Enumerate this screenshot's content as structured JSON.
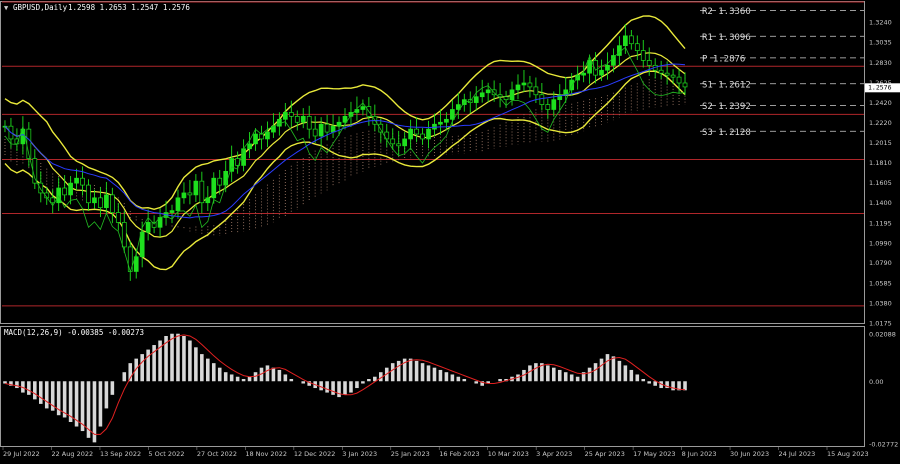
{
  "header": {
    "symbol": "GBPUSD,Daily",
    "ohlc": "1.2598 1.2653 1.2547 1.2576"
  },
  "macd": {
    "label": "MACD(12,26,9) -0.00385 -0.00273",
    "ticks": [
      "0.02088",
      "0.00",
      "-0.02772"
    ]
  },
  "chart_data": {
    "type": "candlestick",
    "symbol": "GBPUSD",
    "timeframe": "Daily",
    "last_price": 1.2576,
    "ylim": [
      1.0175,
      1.3445
    ],
    "y_ticks": [
      1.324,
      1.3035,
      1.283,
      1.2625,
      1.242,
      1.222,
      1.2015,
      1.181,
      1.1605,
      1.14,
      1.1195,
      1.099,
      1.079,
      1.0585,
      1.038,
      1.0175
    ],
    "y_tick_labels": [
      "1.3240",
      "1.3035",
      "1.2830",
      "1.2625",
      "1.2420",
      "1.2220",
      "1.2015",
      "1.1810",
      "1.1605",
      "1.1400",
      "1.1195",
      "1.0990",
      "1.0790",
      "1.0585",
      "1.0380",
      "1.0175"
    ],
    "x_labels": [
      "29 Jul 2022",
      "22 Aug 2022",
      "13 Sep 2022",
      "5 Oct 2022",
      "27 Oct 2022",
      "18 Nov 2022",
      "12 Dec 2022",
      "3 Jan 2023",
      "25 Jan 2023",
      "16 Feb 2023",
      "10 Mar 2023",
      "3 Apr 2023",
      "25 Apr 2023",
      "17 May 2023",
      "8 Jun 2023",
      "30 Jun 2023",
      "24 Jul 2023",
      "15 Aug 2023"
    ],
    "pivot_levels": [
      {
        "label": "R2 1.3360",
        "value": 1.336
      },
      {
        "label": "R1 1.3096",
        "value": 1.3096
      },
      {
        "label": "P 1.2876",
        "value": 1.2876
      },
      {
        "label": "S1 1.2612",
        "value": 1.2612
      },
      {
        "label": "S2 1.2392",
        "value": 1.2392
      },
      {
        "label": "S3 1.2128",
        "value": 1.2128
      }
    ],
    "horizontal_lines": [
      1.3445,
      1.279,
      1.23,
      1.184,
      1.129,
      1.035
    ],
    "price_path": [
      1.218,
      1.205,
      1.2,
      1.215,
      1.185,
      1.16,
      1.15,
      1.145,
      1.14,
      1.155,
      1.148,
      1.16,
      1.165,
      1.158,
      1.14,
      1.145,
      1.135,
      1.148,
      1.13,
      1.12,
      1.095,
      1.07,
      1.085,
      1.11,
      1.12,
      1.115,
      1.125,
      1.13,
      1.132,
      1.145,
      1.15,
      1.148,
      1.162,
      1.14,
      1.145,
      1.165,
      1.158,
      1.172,
      1.185,
      1.178,
      1.195,
      1.2,
      1.21,
      1.205,
      1.212,
      1.218,
      1.225,
      1.232,
      1.228,
      1.222,
      1.228,
      1.215,
      1.208,
      1.22,
      1.212,
      1.218,
      1.222,
      1.228,
      1.232,
      1.235,
      1.238,
      1.228,
      1.22,
      1.212,
      1.205,
      1.2,
      1.198,
      1.205,
      1.215,
      1.21,
      1.205,
      1.215,
      1.22,
      1.222,
      1.225,
      1.235,
      1.24,
      1.245,
      1.242,
      1.248,
      1.252,
      1.255,
      1.25,
      1.248,
      1.245,
      1.255,
      1.26,
      1.262,
      1.258,
      1.25,
      1.24,
      1.235,
      1.245,
      1.25,
      1.255,
      1.265,
      1.27,
      1.272,
      1.285,
      1.27,
      1.275,
      1.28,
      1.29,
      1.3,
      1.31,
      1.302,
      1.295,
      1.285,
      1.28,
      1.275,
      1.272,
      1.27,
      1.268,
      1.262,
      1.258
    ],
    "macd_path": [
      -0.001,
      -0.002,
      -0.003,
      -0.005,
      -0.006,
      -0.008,
      -0.01,
      -0.012,
      -0.013,
      -0.015,
      -0.016,
      -0.018,
      -0.02,
      -0.022,
      -0.025,
      -0.027,
      -0.02,
      -0.012,
      -0.006,
      0.0,
      0.004,
      0.008,
      0.01,
      0.012,
      0.014,
      0.016,
      0.018,
      0.02,
      0.021,
      0.021,
      0.02,
      0.018,
      0.015,
      0.012,
      0.01,
      0.008,
      0.006,
      0.004,
      0.003,
      0.002,
      0.001,
      0.002,
      0.004,
      0.006,
      0.007,
      0.006,
      0.005,
      0.003,
      0.001,
      0.0,
      -0.001,
      -0.002,
      -0.003,
      -0.004,
      -0.005,
      -0.006,
      -0.007,
      -0.006,
      -0.005,
      -0.003,
      -0.001,
      0.001,
      0.002,
      0.004,
      0.006,
      0.008,
      0.009,
      0.01,
      0.01,
      0.009,
      0.008,
      0.007,
      0.006,
      0.005,
      0.004,
      0.003,
      0.002,
      0.001,
      0.0,
      -0.001,
      -0.002,
      -0.001,
      0.0,
      0.001,
      0.001,
      0.002,
      0.003,
      0.005,
      0.007,
      0.008,
      0.008,
      0.007,
      0.006,
      0.005,
      0.004,
      0.003,
      0.002,
      0.004,
      0.006,
      0.008,
      0.01,
      0.012,
      0.011,
      0.009,
      0.007,
      0.005,
      0.003,
      0.001,
      -0.001,
      -0.002,
      -0.003,
      -0.003,
      -0.004,
      -0.004,
      -0.004
    ]
  }
}
